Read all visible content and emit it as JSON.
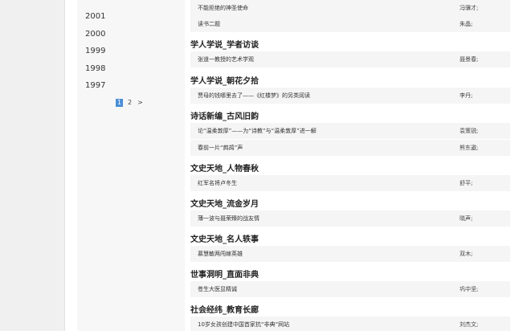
{
  "years": [
    "2001",
    "2000",
    "1999",
    "1998",
    "1997"
  ],
  "pager": {
    "page1": "1",
    "page2": "2",
    "next": ">"
  },
  "sections": [
    {
      "title": "",
      "rows": [
        {
          "title": "不能拒绝的神圣使命",
          "author": "冯骥才;"
        },
        {
          "title": "读书二题",
          "author": "朱晶;"
        }
      ]
    },
    {
      "title": "学人学说_学者访谈",
      "rows": [
        {
          "title": "张道一教授的艺术学观",
          "author": "聂景春;"
        }
      ]
    },
    {
      "title": "学人学说_朝花夕拾",
      "rows": [
        {
          "title": "贾母的钱哪里去了——《红楼梦》的另类阅读",
          "author": "李丹;"
        }
      ]
    },
    {
      "title": "诗话新编_古风旧韵",
      "rows": [
        {
          "title": "论“温柔敦厚”——为“诗教”与“温柔敦厚”进一解",
          "author": "袁策锐;"
        },
        {
          "title": "春前一片“鹧鸪”声",
          "author": "熊东遨;"
        }
      ]
    },
    {
      "title": "文史天地_人物春秋",
      "rows": [
        {
          "title": "红军名将卢冬生",
          "author": "舒平;"
        }
      ]
    },
    {
      "title": "文史天地_流金岁月",
      "rows": [
        {
          "title": "薄一波与聂荣臻的战友情",
          "author": "晓声;"
        }
      ]
    },
    {
      "title": "文史天地_名人轶事",
      "rows": [
        {
          "title": "慕慧敏两闯嫁英雄",
          "author": "双木;"
        }
      ]
    },
    {
      "title": "世事洞明_直面非典",
      "rows": [
        {
          "title": "苍生大医显精诚",
          "author": "巩中坚;"
        }
      ]
    },
    {
      "title": "社会经纬_教育长廊",
      "rows": [
        {
          "title": "10岁女孩创建中国首家抗“非典”网站",
          "author": "刘杰文;"
        }
      ]
    }
  ]
}
